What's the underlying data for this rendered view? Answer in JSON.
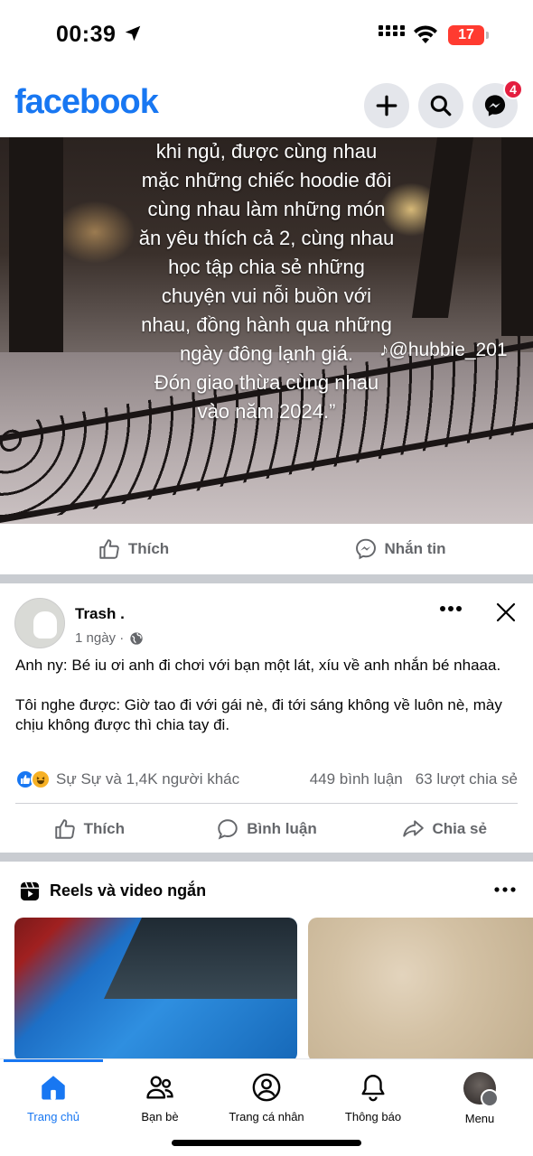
{
  "status_bar": {
    "time": "00:39",
    "battery": "17"
  },
  "header": {
    "logo": "facebook",
    "messenger_badge": "4"
  },
  "video_post": {
    "caption_lines": [
      "khi ngủ, được cùng nhau",
      "mặc những chiếc hoodie đôi",
      "cùng nhau làm những món",
      "ăn yêu thích cả 2, cùng nhau",
      "học tập chia sẻ những",
      "chuyện vui nỗi buồn với",
      "nhau, đồng hành qua những",
      "ngày đông lạnh giá.",
      "Đón giao thừa cùng nhau",
      "vào năm 2024.”"
    ],
    "watermark": "♪@hubbie_201",
    "like_label": "Thích",
    "message_label": "Nhắn tin"
  },
  "post": {
    "author": "Trash .",
    "time": "1 ngày ·",
    "paragraphs": [
      "Anh ny: Bé iu ơi anh đi chơi với bạn một lát, xíu về anh nhắn bé nhaaa.",
      "Tôi nghe được: Giờ tao đi với gái nè, đi tới sáng không về luôn nè, mày chịu không được thì chia tay đi."
    ],
    "reactions_text": "Sự Sự và 1,4K người khác",
    "comments": "449 bình luận",
    "shares": "63 lượt chia sẻ",
    "like_label": "Thích",
    "comment_label": "Bình luận",
    "share_label": "Chia sẻ"
  },
  "reels": {
    "title": "Reels và video ngắn"
  },
  "bottom_nav": [
    {
      "label": "Trang chủ",
      "icon": "home-icon",
      "active": true
    },
    {
      "label": "Bạn bè",
      "icon": "friends-icon",
      "active": false
    },
    {
      "label": "Trang cá nhân",
      "icon": "profile-icon",
      "active": false
    },
    {
      "label": "Thông báo",
      "icon": "bell-icon",
      "active": false
    },
    {
      "label": "Menu",
      "icon": "menu-avatar",
      "active": false
    }
  ],
  "colors": {
    "brand": "#1877f2",
    "badge": "#e41e3f",
    "muted": "#65676b"
  }
}
